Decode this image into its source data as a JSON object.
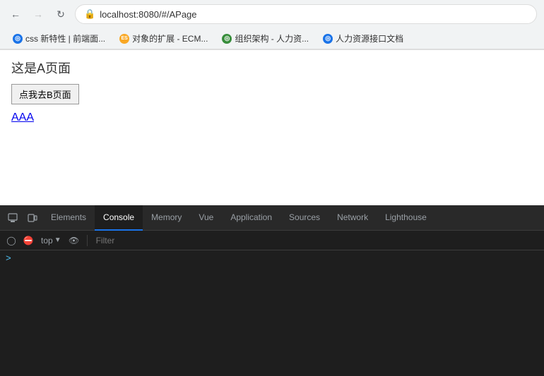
{
  "browser": {
    "url": "localhost:8080/#/APage",
    "back_disabled": false,
    "forward_disabled": false
  },
  "bookmarks": [
    {
      "id": "bm1",
      "label": "css 新特性 | 前端面...",
      "icon_color": "#1a73e8",
      "icon_text": "◎"
    },
    {
      "id": "bm2",
      "label": "对象的扩展 - ECM...",
      "icon_color": "#f9a825",
      "icon_text": "ES"
    },
    {
      "id": "bm3",
      "label": "组织架构 - 人力资...",
      "icon_color": "#388e3c",
      "icon_text": "◎"
    },
    {
      "id": "bm4",
      "label": "人力资源接口文档",
      "icon_color": "#1a73e8",
      "icon_text": "◎"
    }
  ],
  "page": {
    "title": "这是A页面",
    "button_label": "点我去B页面",
    "link_text": "AAA"
  },
  "devtools": {
    "tabs": [
      {
        "id": "elements",
        "label": "Elements",
        "active": false
      },
      {
        "id": "console",
        "label": "Console",
        "active": true
      },
      {
        "id": "memory",
        "label": "Memory",
        "active": false
      },
      {
        "id": "vue",
        "label": "Vue",
        "active": false
      },
      {
        "id": "application",
        "label": "Application",
        "active": false
      },
      {
        "id": "sources",
        "label": "Sources",
        "active": false
      },
      {
        "id": "network",
        "label": "Network",
        "active": false
      },
      {
        "id": "lighthouse",
        "label": "Lighthouse",
        "active": false
      }
    ],
    "toolbar": {
      "context": "top",
      "filter_placeholder": "Filter"
    }
  }
}
